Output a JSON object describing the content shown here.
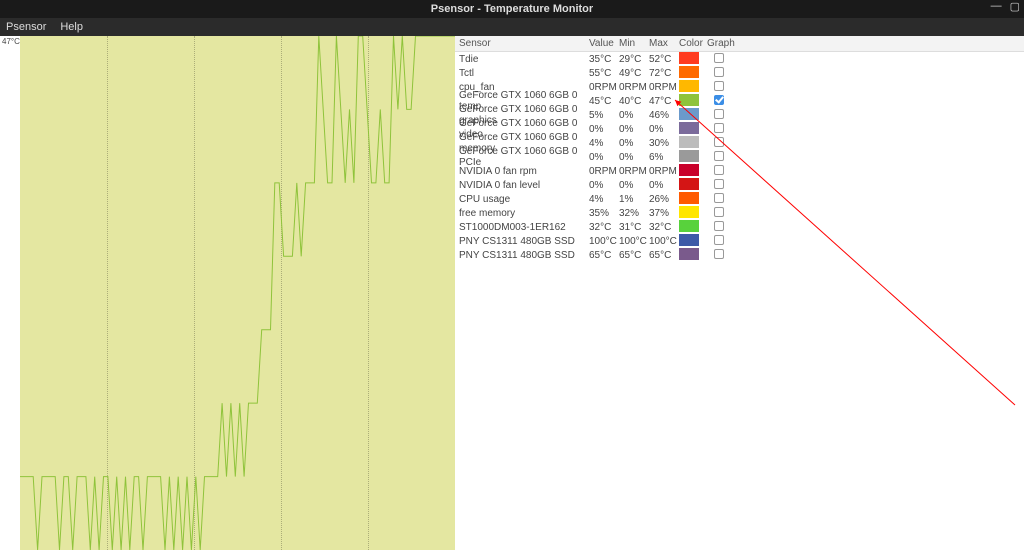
{
  "window": {
    "title": "Psensor - Temperature Monitor"
  },
  "menubar": {
    "items": [
      "Psensor",
      "Help"
    ]
  },
  "graph": {
    "y_label": "47°C"
  },
  "table": {
    "headers": {
      "sensor": "Sensor",
      "value": "Value",
      "min": "Min",
      "max": "Max",
      "color": "Color",
      "graph": "Graph"
    },
    "rows": [
      {
        "sensor": "Tdie",
        "value": "35°C",
        "min": "29°C",
        "max": "52°C",
        "color": "#ff3b1f",
        "graph": false
      },
      {
        "sensor": "Tctl",
        "value": "55°C",
        "min": "49°C",
        "max": "72°C",
        "color": "#ff6a00",
        "graph": false
      },
      {
        "sensor": "cpu_fan",
        "value": "0RPM",
        "min": "0RPM",
        "max": "0RPM",
        "color": "#ffb800",
        "graph": false
      },
      {
        "sensor": "GeForce GTX 1060 6GB 0 temp",
        "value": "45°C",
        "min": "40°C",
        "max": "47°C",
        "color": "#8fc33b",
        "graph": true
      },
      {
        "sensor": "GeForce GTX 1060 6GB 0 graphics",
        "value": "5%",
        "min": "0%",
        "max": "46%",
        "color": "#6b9acb",
        "graph": false
      },
      {
        "sensor": "GeForce GTX 1060 6GB 0 video",
        "value": "0%",
        "min": "0%",
        "max": "0%",
        "color": "#7b6b9b",
        "graph": false
      },
      {
        "sensor": "GeForce GTX 1060 6GB 0 memory",
        "value": "4%",
        "min": "0%",
        "max": "30%",
        "color": "#bcbcbc",
        "graph": false
      },
      {
        "sensor": "GeForce GTX 1060 6GB 0 PCIe",
        "value": "0%",
        "min": "0%",
        "max": "6%",
        "color": "#9a9a9a",
        "graph": false
      },
      {
        "sensor": "NVIDIA 0 fan rpm",
        "value": "0RPM",
        "min": "0RPM",
        "max": "0RPM",
        "color": "#c9002a",
        "graph": false
      },
      {
        "sensor": "NVIDIA 0 fan level",
        "value": "0%",
        "min": "0%",
        "max": "0%",
        "color": "#d41515",
        "graph": false
      },
      {
        "sensor": "CPU usage",
        "value": "4%",
        "min": "1%",
        "max": "26%",
        "color": "#ff5a00",
        "graph": false
      },
      {
        "sensor": "free memory",
        "value": "35%",
        "min": "32%",
        "max": "37%",
        "color": "#ffe600",
        "graph": false
      },
      {
        "sensor": "ST1000DM003-1ER162",
        "value": "32°C",
        "min": "31°C",
        "max": "32°C",
        "color": "#58d23c",
        "graph": false
      },
      {
        "sensor": "PNY CS1311 480GB SSD",
        "value": "100°C",
        "min": "100°C",
        "max": "100°C",
        "color": "#3d5aa8",
        "graph": false
      },
      {
        "sensor": "PNY CS1311 480GB SSD",
        "value": "65°C",
        "min": "65°C",
        "max": "65°C",
        "color": "#7a5a8c",
        "graph": false
      }
    ]
  },
  "chart_data": {
    "type": "line",
    "title": "",
    "xlabel": "",
    "ylabel": "",
    "ylim": [
      40,
      47
    ],
    "series": [
      {
        "name": "GeForce GTX 1060 6GB 0 temp",
        "color": "#8fc33b",
        "values": [
          41,
          41,
          41,
          41,
          40,
          41,
          41,
          41,
          41,
          40,
          41,
          41,
          40,
          41,
          41,
          41,
          40,
          41,
          40,
          41,
          41,
          40,
          41,
          40,
          41,
          40,
          41,
          41,
          40,
          41,
          41,
          41,
          41,
          40,
          41,
          40,
          41,
          40,
          41,
          40,
          41,
          40,
          41,
          41,
          41,
          41,
          42,
          41,
          42,
          41,
          42,
          41,
          42,
          42,
          42,
          43,
          43,
          43,
          45,
          45,
          44,
          44,
          44,
          45,
          44,
          45,
          45,
          45,
          47,
          46,
          45,
          45,
          47,
          46,
          45,
          46,
          45,
          47,
          47,
          46,
          45,
          45,
          46,
          45,
          45,
          47,
          46,
          47,
          46,
          46,
          47,
          47,
          47,
          47,
          47,
          47,
          47,
          47,
          47,
          47
        ]
      }
    ]
  }
}
